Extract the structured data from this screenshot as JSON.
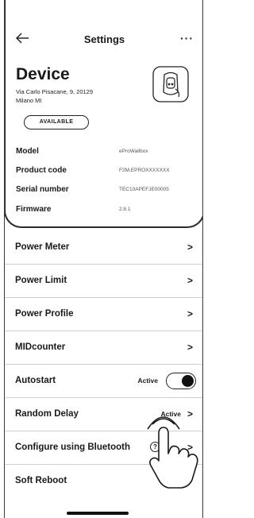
{
  "header": {
    "title": "Settings",
    "more": "···"
  },
  "device": {
    "title": "Device",
    "address_line1": "Via Carlo Pisacane, 9, 20129",
    "address_line2": "Milano MI",
    "status_badge": "AVAILABLE",
    "info": [
      {
        "label": "Model",
        "value": "eProWallbox"
      },
      {
        "label": "Product code",
        "value": "F2M.EPROXXXXXXX"
      },
      {
        "label": "Serial number",
        "value": "TEC10APEFJE00005"
      },
      {
        "label": "Firmware",
        "value": "2.8.1"
      }
    ]
  },
  "menu": {
    "items": [
      {
        "label": "Power Meter"
      },
      {
        "label": "Power Limit"
      },
      {
        "label": "Power Profile"
      },
      {
        "label": "MIDcounter"
      },
      {
        "label": "Autostart",
        "status": "Active",
        "toggle_on": true
      },
      {
        "label": "Random Delay",
        "status": "Active"
      },
      {
        "label": "Configure using Bluetooth",
        "help": "?"
      },
      {
        "label": "Soft Reboot"
      }
    ],
    "chevron": ">"
  },
  "icons": {
    "back": "arrow-left-icon",
    "charger": "wallbox-charger-icon",
    "hand": "tap-hand-icon"
  },
  "colors": {
    "text": "#1a1a1a",
    "border": "#2a2a2a",
    "divider": "#cfcfcf",
    "secondary_text": "#555555"
  }
}
